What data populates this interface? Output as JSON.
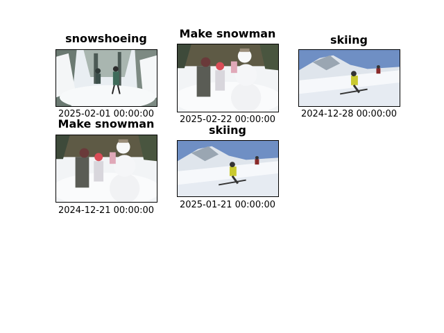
{
  "panels": [
    {
      "title": "snowshoeing",
      "date": "2025-02-01 00:00:00",
      "image": "snowshoeing-photo"
    },
    {
      "title": "Make snowman",
      "date": "2025-02-22 00:00:00",
      "image": "snowman-photo"
    },
    {
      "title": "skiing",
      "date": "2024-12-28 00:00:00",
      "image": "skiing-photo"
    },
    {
      "title": "Make snowman",
      "date": "2024-12-21 00:00:00",
      "image": "snowman-photo"
    },
    {
      "title": "skiing",
      "date": "2025-01-21 00:00:00",
      "image": "skiing-photo"
    }
  ]
}
